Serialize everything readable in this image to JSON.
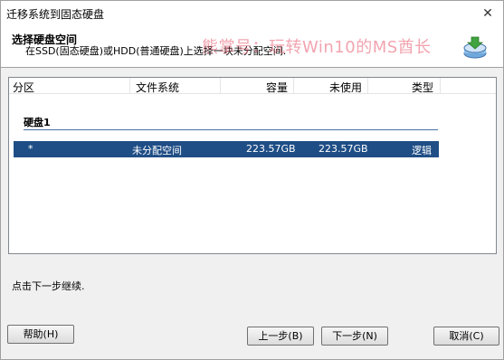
{
  "window": {
    "title": "迁移系统到固态硬盘",
    "close_glyph": "✕"
  },
  "header": {
    "title": "选择硬盘空间",
    "subtitle": "在SSD(固态硬盘)或HDD(普通硬盘)上选择一块未分配空间."
  },
  "watermark": "熊掌号：玩转Win10的MS酋长",
  "table": {
    "columns": [
      "分区",
      "文件系统",
      "容量",
      "未使用",
      "类型"
    ],
    "disk_label": "硬盘1",
    "rows": [
      {
        "partition": "*",
        "filesystem": "未分配空间",
        "capacity": "223.57GB",
        "unused": "223.57GB",
        "type": "逻辑",
        "selected": true
      }
    ]
  },
  "hint": "点击下一步继续.",
  "buttons": {
    "help": "帮助(H)",
    "back": "上一步(B)",
    "next": "下一步(N)",
    "cancel": "取消(C)"
  },
  "colors": {
    "selection": "#1f4e86",
    "watermark": "#e75a6e",
    "disk_line": "#4a6fa5"
  },
  "icons": {
    "header": "disk-migrate-icon",
    "close": "close-icon"
  }
}
